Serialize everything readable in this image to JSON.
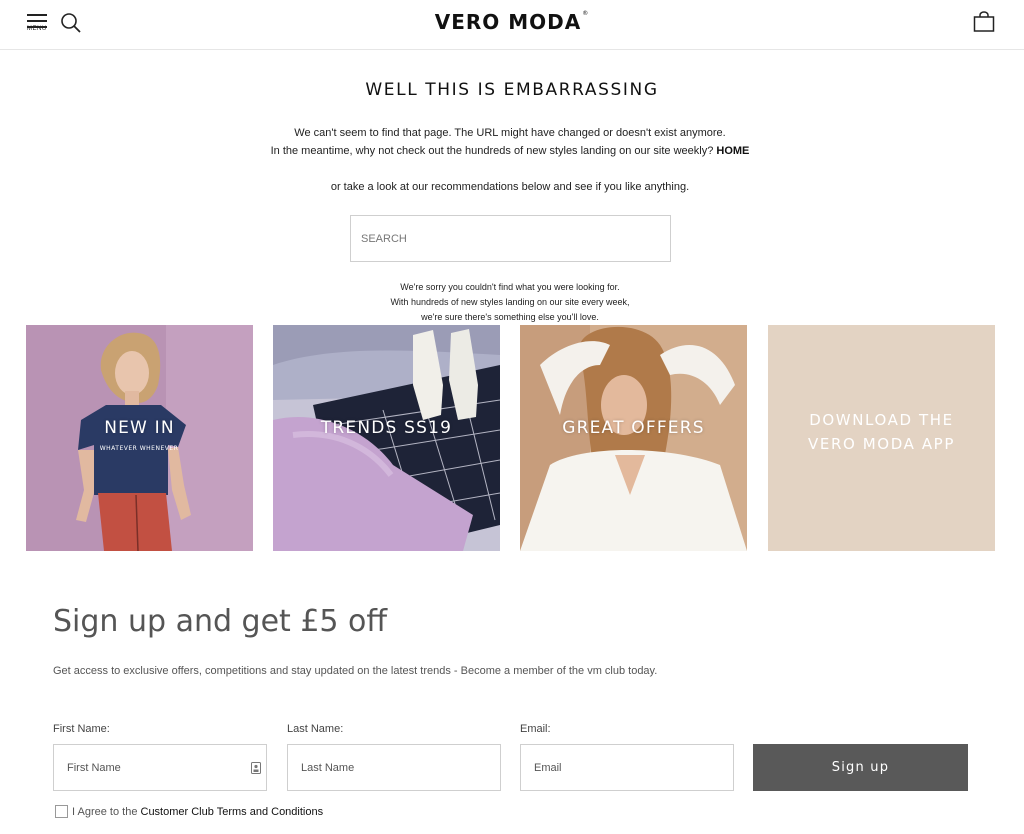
{
  "header": {
    "menu_label": "MENU",
    "logo": "VERO MODA",
    "logo_mark": "®"
  },
  "notfound": {
    "title": "WELL THIS IS EMBARRASSING",
    "line1": "We can't seem to find that page. The URL might have changed or doesn't exist anymore.",
    "line2": "In the meantime, why not check out the hundreds of new styles landing on our site weekly?",
    "home_link": "HOME",
    "line3": "or take a look at our recommendations below and see if you like anything.",
    "search_placeholder": "SEARCH",
    "sorry1": "We're sorry you couldn't find what you were looking for.",
    "sorry2": "With hundreds of new styles landing on our site every week,",
    "sorry3": "we're sure there's something else you'll love."
  },
  "tiles": [
    {
      "label": "NEW IN",
      "tee_text": "WHATEVER WHENEVER"
    },
    {
      "label": "TRENDS SS19"
    },
    {
      "label": "GREAT OFFERS"
    },
    {
      "label_line1": "DOWNLOAD THE",
      "label_line2": "VERO MODA APP"
    }
  ],
  "signup": {
    "title": "Sign up and get £5 off",
    "subtitle": "Get access to exclusive offers, competitions and stay updated on the latest trends - Become a member of the vm club today.",
    "first_name_label": "First Name:",
    "first_name_placeholder": "First Name",
    "last_name_label": "Last Name:",
    "last_name_placeholder": "Last Name",
    "email_label": "Email:",
    "email_placeholder": "Email",
    "button": "Sign up",
    "agree_prefix": "I Agree to the",
    "terms_link": "Customer Club Terms and Conditions"
  },
  "colors": {
    "button_bg": "#595959",
    "app_tile_bg": "#e3d3c3",
    "tile1_bg": "#b993b4",
    "tile2_bg": "#c6c4d6",
    "tile3_bg": "#d2ad8d"
  }
}
